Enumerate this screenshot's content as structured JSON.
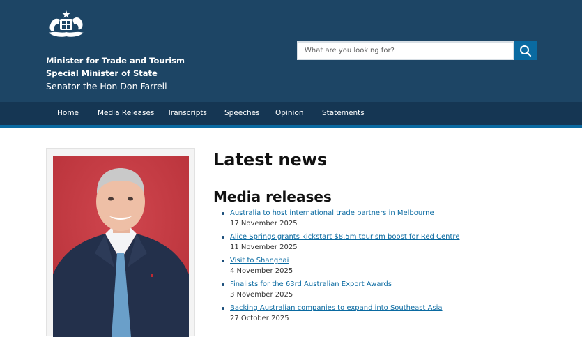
{
  "header": {
    "crest_icon": "coat-of-arms-icon",
    "title_line1": "Minister for Trade and Tourism",
    "title_line2": "Special Minister of State",
    "title_line3": "Senator the Hon Don Farrell"
  },
  "search": {
    "placeholder": "What are you looking for?",
    "button_icon": "search-icon"
  },
  "nav": {
    "items": [
      {
        "label": "Home"
      },
      {
        "label": "Media Releases"
      },
      {
        "label": "Transcripts"
      },
      {
        "label": "Speeches"
      },
      {
        "label": "Opinion"
      },
      {
        "label": "Statements"
      }
    ]
  },
  "main": {
    "heading": "Latest news",
    "media_heading": "Media releases",
    "releases": [
      {
        "title": "Australia to host international trade partners in Melbourne",
        "date": "17 November 2025"
      },
      {
        "title": "Alice Springs grants kickstart $8.5m tourism boost for Red Centre",
        "date": "11 November 2025"
      },
      {
        "title": "Visit to Shanghai",
        "date": "4 November 2025"
      },
      {
        "title": "Finalists for the 63rd Australian Export Awards",
        "date": "3 November 2025"
      },
      {
        "title": "Backing Australian companies to expand into Southeast Asia",
        "date": "27 October 2025"
      }
    ]
  },
  "colors": {
    "header_bg": "#1d4565",
    "nav_bg": "#153653",
    "accent": "#0a6aa1"
  }
}
